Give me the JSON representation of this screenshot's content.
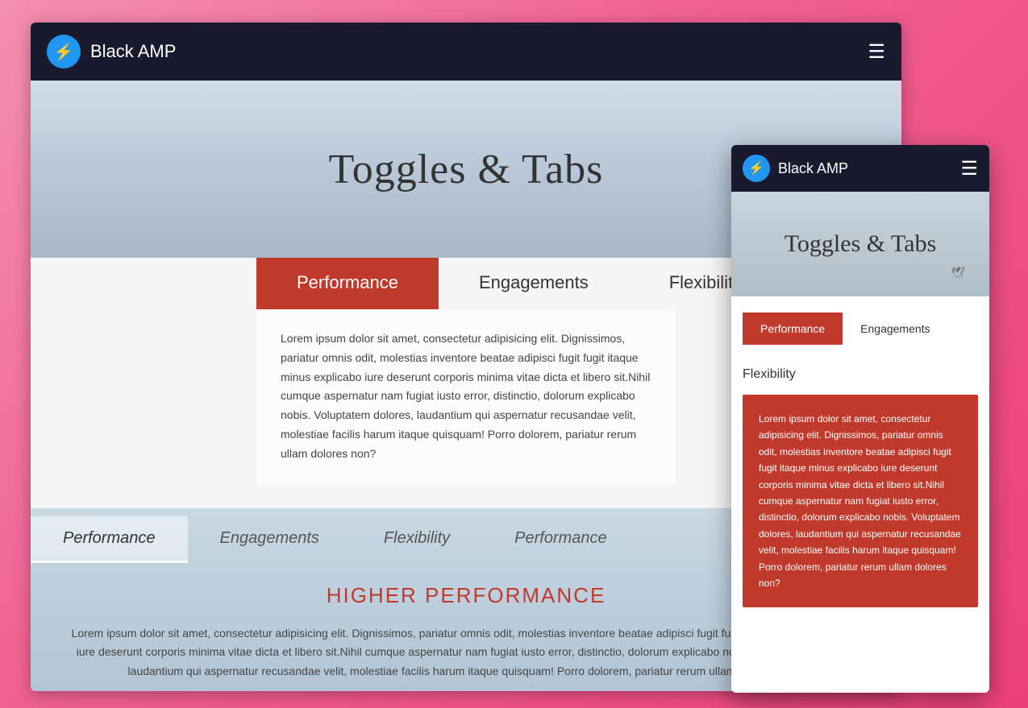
{
  "main_window": {
    "navbar": {
      "brand_name": "Black AMP",
      "hamburger": "≡"
    },
    "hero": {
      "title": "Toggles & Tabs"
    },
    "tab_section_1": {
      "tabs": [
        {
          "label": "Performance",
          "active": true
        },
        {
          "label": "Engagements",
          "active": false
        },
        {
          "label": "Flexibility",
          "active": false
        }
      ],
      "content": "Lorem ipsum dolor sit amet, consectetur adipisicing elit. Dignissimos, pariatur omnis odit, molestias inventore beatae adipisci fugit fugit itaque minus explicabo iure deserunt corporis minima vitae dicta et libero sit.Nihil cumque aspernatur nam fugiat iusto error, distinctio, dolorum explicabo nobis. Voluptatem dolores, laudantium qui aspernatur recusandae velit, molestiae facilis harum itaque quisquam! Porro dolorem, pariatur rerum ullam dolores non?"
    },
    "tab_section_2": {
      "tabs": [
        {
          "label": "Performance",
          "active": true,
          "italic": true
        },
        {
          "label": "Engagements",
          "active": false,
          "italic": true
        },
        {
          "label": "Flexibility",
          "active": false,
          "italic": true
        },
        {
          "label": "Performance",
          "active": false,
          "italic": true
        }
      ],
      "higher_performance": "HIGHER PERFORMANCE",
      "content": "Lorem ipsum dolor sit amet, consectetur adipisicing elit. Dignissimos, pariatur omnis odit, molestias inventore beatae adipisci fugit fugit itaque minus explicabo iure deserunt corporis minima vitae dicta et libero sit.Nihil cumque aspernatur nam fugiat iusto error, distinctio, dolorum explicabo nobis. Voluptatem dolores, laudantium qui aspernatur recusandae velit, molestiae facilis harum itaque quisquam! Porro dolorem, pariatur rerum ullam dolores non?"
    }
  },
  "mobile_window": {
    "navbar": {
      "brand_name": "Black AMP",
      "hamburger": "≡"
    },
    "hero": {
      "title": "Toggles & Tabs"
    },
    "tab_area": {
      "tabs_row1": [
        {
          "label": "Performance",
          "active": true
        },
        {
          "label": "Engagements",
          "active": false
        }
      ],
      "flexibility_label": "Flexibility",
      "content": "Lorem ipsum dolor sit amet, consectetur adipisicing elit. Dignissimos, pariatur omnis odit, molestias inventore beatae adipisci fugit fugit itaque minus explicabo iure deserunt corporis minima vitae dicta et libero sit.Nihil cumque aspernatur nam fugiat iusto error, distinctio, dolorum explicabo nobis. Voluptatem dolores, laudantium qui aspernatur recusandae velit, molestiae facilis harum itaque quisquam! Porro dolorem, pariatur rerum ullam dolores non?"
    }
  },
  "colors": {
    "active_tab": "#c0392b",
    "navbar_bg": "#1a1a2e",
    "brand_icon_bg": "#2196f3",
    "background_gradient_start": "#f48fb1",
    "background_gradient_end": "#ec407a"
  },
  "icons": {
    "lightning": "⚡",
    "hamburger": "☰"
  }
}
